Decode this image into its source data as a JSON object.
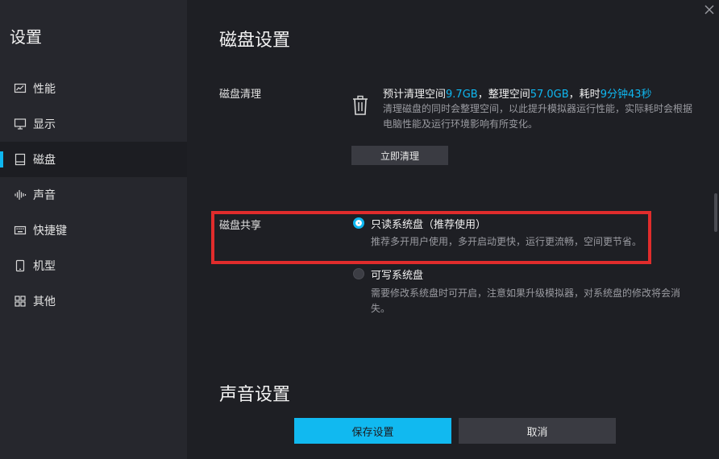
{
  "app": {
    "title": "设置"
  },
  "sidebar": {
    "items": [
      {
        "label": "性能",
        "icon": "performance-icon"
      },
      {
        "label": "显示",
        "icon": "monitor-icon"
      },
      {
        "label": "磁盘",
        "icon": "disk-icon",
        "active": true
      },
      {
        "label": "声音",
        "icon": "sound-wave-icon"
      },
      {
        "label": "快捷键",
        "icon": "keyboard-icon"
      },
      {
        "label": "机型",
        "icon": "phone-icon"
      },
      {
        "label": "其他",
        "icon": "grid-icon"
      }
    ]
  },
  "disk": {
    "title": "磁盘设置",
    "cleanup": {
      "label": "磁盘清理",
      "estimate_label": "预计清理空间",
      "estimate_value": "9.7GB",
      "sep1": "，",
      "organize_label": "整理空间",
      "organize_value": "57.0GB",
      "sep2": "，",
      "time_label": "耗时",
      "time_value": "9分钟43秒",
      "description": "清理磁盘的同时会整理空间，以此提升模拟器运行性能，实际耗时会根据电脑性能及运行环境影响有所变化。",
      "button": "立即清理"
    },
    "sharing": {
      "label": "磁盘共享",
      "options": [
        {
          "label": "只读系统盘（推荐使用）",
          "desc": "推荐多开用户使用，多开启动更快，运行更流畅，空间更节省。",
          "checked": true
        },
        {
          "label": "可写系统盘",
          "desc": "需要修改系统盘时可开启，注意如果升级模拟器，对系统盘的修改将会消失。",
          "checked": false
        }
      ]
    }
  },
  "sound": {
    "title": "声音设置"
  },
  "footer": {
    "save": "保存设置",
    "cancel": "取消"
  },
  "colors": {
    "accent": "#0fb7f0",
    "highlight": "#e02c2c",
    "background": "#1e1f24",
    "sidebar": "#26272d"
  }
}
